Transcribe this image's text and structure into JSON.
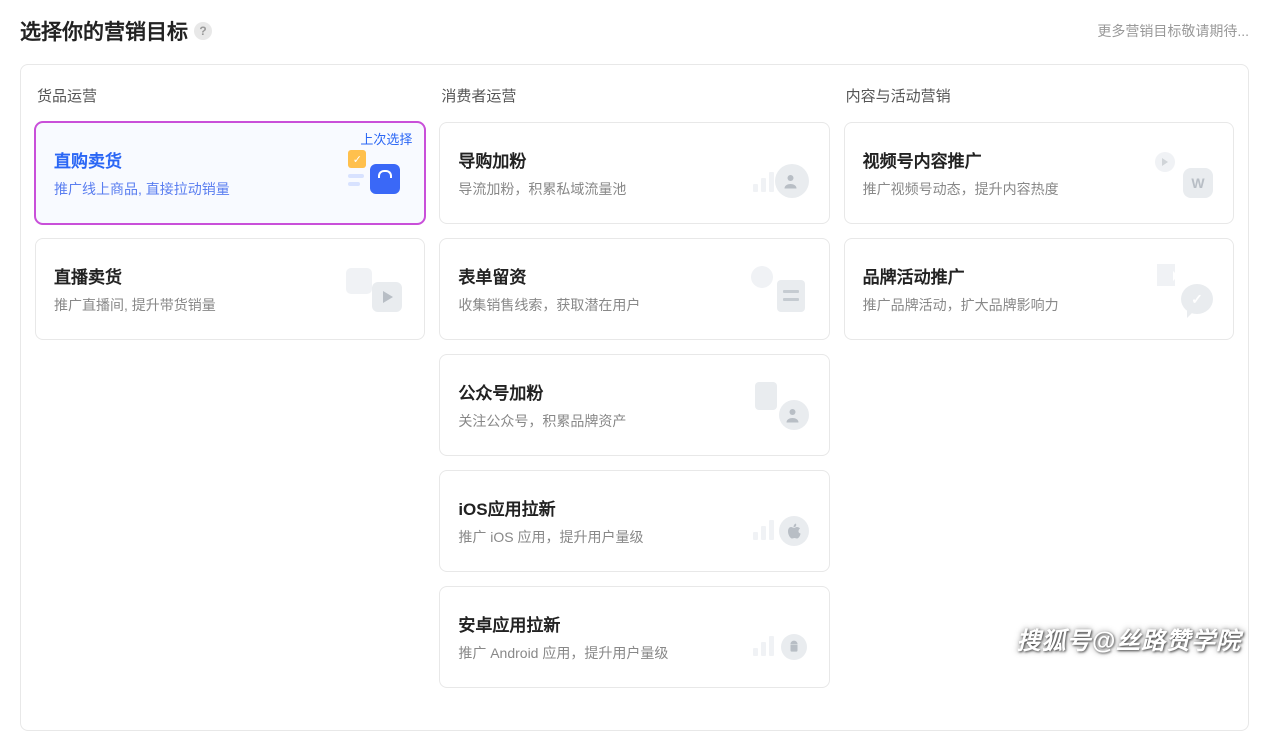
{
  "header": {
    "title": "选择你的营销目标",
    "help_icon": "?",
    "note": "更多营销目标敬请期待..."
  },
  "columns": [
    {
      "title": "货品运营",
      "cards": [
        {
          "title": "直购卖货",
          "desc": "推广线上商品, 直接拉动销量",
          "badge": "上次选择",
          "selected": true,
          "icon": "bag"
        },
        {
          "title": "直播卖货",
          "desc": "推广直播间, 提升带货销量",
          "icon": "live"
        }
      ]
    },
    {
      "title": "消费者运营",
      "cards": [
        {
          "title": "导购加粉",
          "desc": "导流加粉，积累私域流量池",
          "icon": "guide-fan"
        },
        {
          "title": "表单留资",
          "desc": "收集销售线索，获取潜在用户",
          "icon": "form"
        },
        {
          "title": "公众号加粉",
          "desc": "关注公众号，积累品牌资产",
          "icon": "official-fan"
        },
        {
          "title": "iOS应用拉新",
          "desc": "推广 iOS 应用，提升用户量级",
          "icon": "ios"
        },
        {
          "title": "安卓应用拉新",
          "desc": "推广 Android 应用，提升用户量级",
          "icon": "android"
        }
      ]
    },
    {
      "title": "内容与活动营销",
      "cards": [
        {
          "title": "视频号内容推广",
          "desc": "推广视频号动态，提升内容热度",
          "icon": "video"
        },
        {
          "title": "品牌活动推广",
          "desc": "推广品牌活动，扩大品牌影响力",
          "icon": "brand"
        }
      ]
    }
  ],
  "watermark": "搜狐号@丝路赞学院"
}
